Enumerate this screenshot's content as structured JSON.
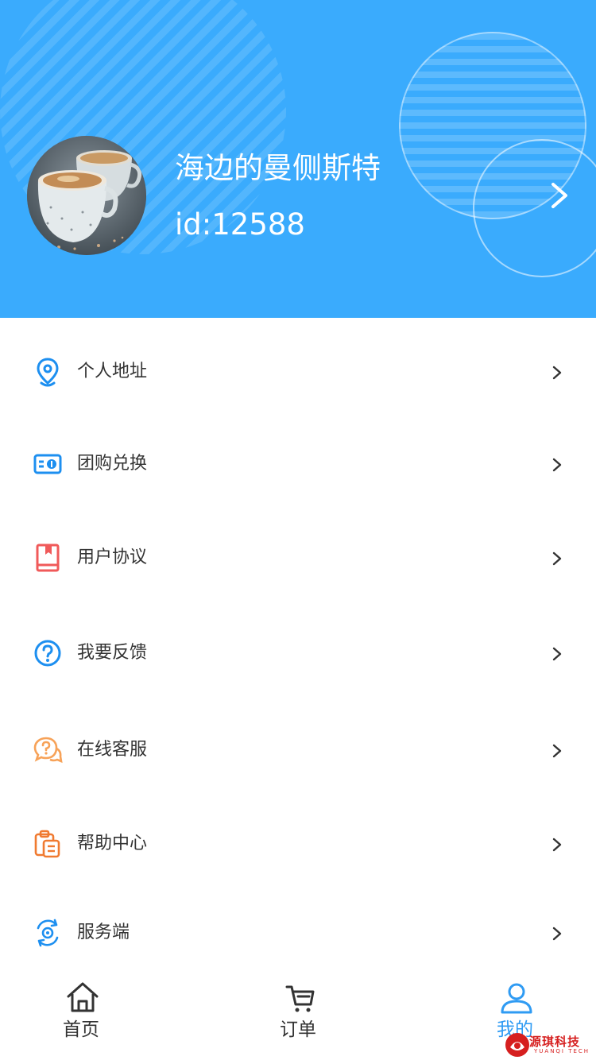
{
  "profile": {
    "username": "海边的曼侧斯特",
    "id_text": "id:12588",
    "avatar_icon": "coffee-cups-photo",
    "arrow_icon": "chevron-right-icon"
  },
  "menu": {
    "items": [
      {
        "label": "个人地址",
        "icon": "location-pin-icon",
        "color": "#1d8ff0"
      },
      {
        "label": "团购兑换",
        "icon": "coupon-card-icon",
        "color": "#1d8ff0"
      },
      {
        "label": "用户协议",
        "icon": "book-bookmark-icon",
        "color": "#f05a5a"
      },
      {
        "label": "我要反馈",
        "icon": "question-circle-icon",
        "color": "#1d8ff0"
      },
      {
        "label": "在线客服",
        "icon": "chat-question-icon",
        "color": "#f7a258"
      },
      {
        "label": "帮助中心",
        "icon": "clipboard-icon",
        "color": "#f07a30"
      },
      {
        "label": "服务端",
        "icon": "rotate-gear-icon",
        "color": "#1d8ff0"
      }
    ]
  },
  "tabbar": {
    "tabs": [
      {
        "label": "首页",
        "icon": "home-icon",
        "active": false
      },
      {
        "label": "订单",
        "icon": "cart-icon",
        "active": false
      },
      {
        "label": "我的",
        "icon": "user-icon",
        "active": true
      }
    ]
  },
  "watermark": {
    "text": "源琪科技",
    "sub": "YUANQI TECH"
  },
  "colors": {
    "header": "#3aabfd",
    "active_tab": "#2f9bf3",
    "text": "#333333"
  }
}
